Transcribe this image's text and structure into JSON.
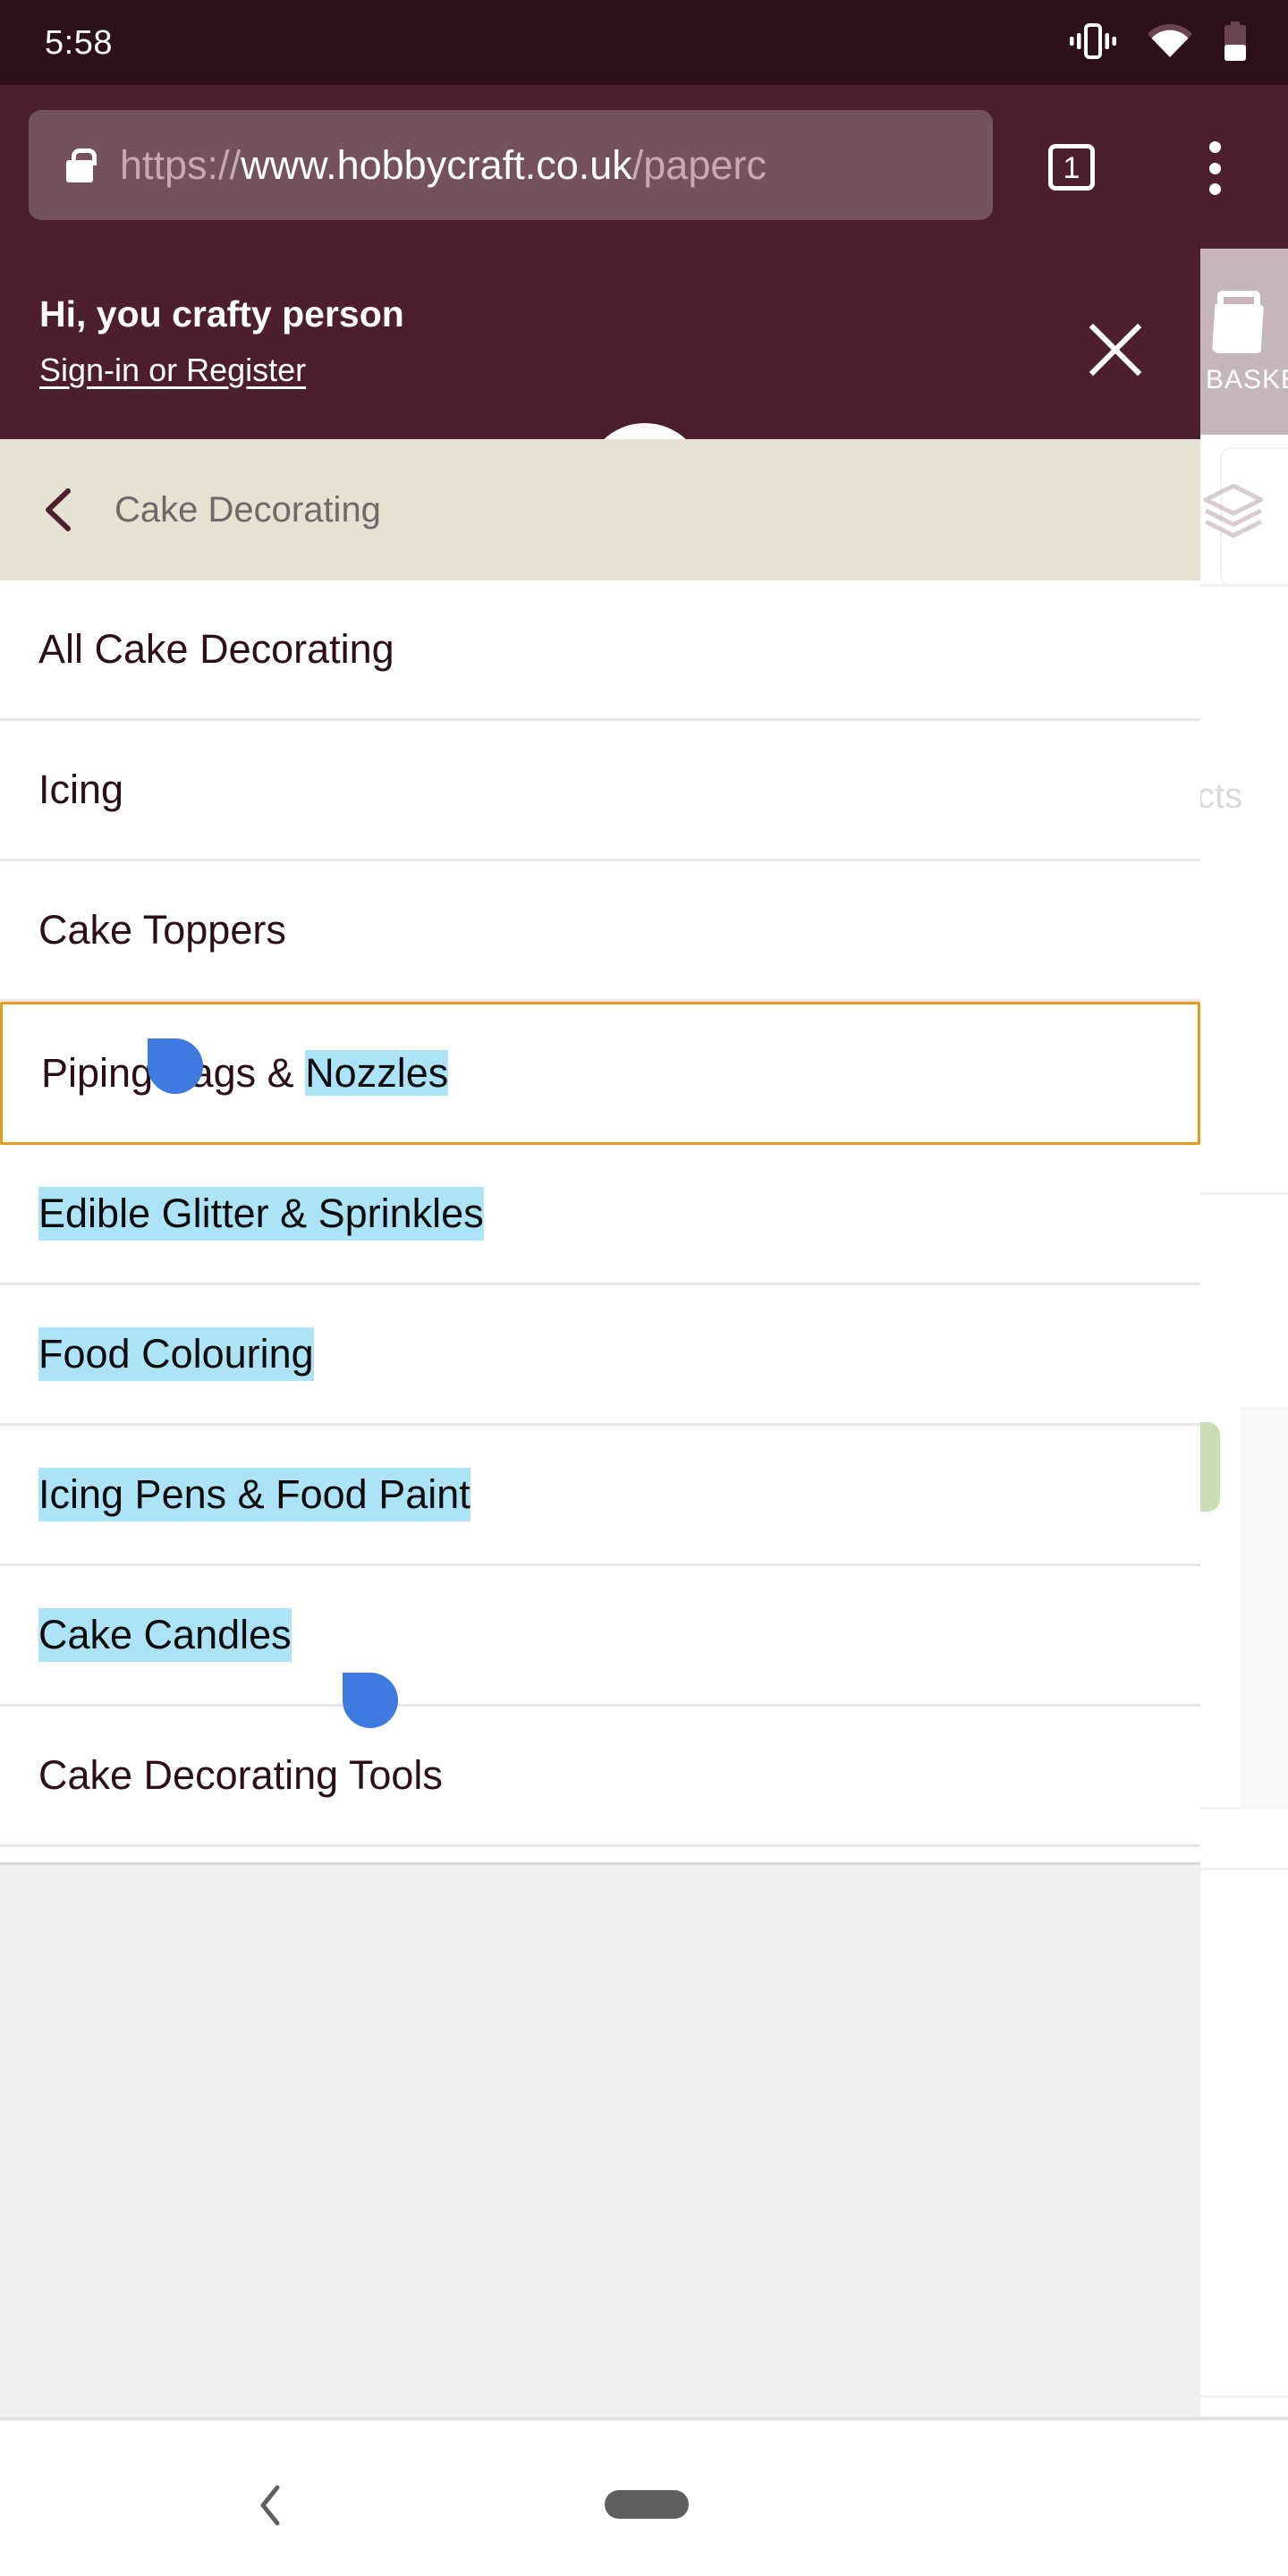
{
  "status_bar": {
    "clock": "5:58",
    "icons": [
      "vibrate-icon",
      "wifi-icon",
      "battery-icon"
    ],
    "battery_level_percent": 40,
    "background_color": "#2c1119"
  },
  "browser": {
    "url_scheme": "https://",
    "url_host": "www.hobbycraft.co.uk",
    "url_path": "/paperc",
    "lock_icon": "lock-icon",
    "tab_count": "1",
    "menu_icon": "overflow-menu-icon",
    "chrome_color": "#4d1f2d"
  },
  "refresh": {
    "icon": "refresh-arrow-icon",
    "accent_color": "#3f7ae0"
  },
  "account_banner": {
    "greeting": "Hi, you crafty person",
    "signin_label": "Sign-in or Register",
    "close_icon": "close-icon",
    "background_color": "#4d1f2d"
  },
  "background_page": {
    "basket_label": "BASKET",
    "basket_icon": "shopping-basket-icon",
    "layers_icon": "layers-icon",
    "products_text": "cts",
    "accent_green": "#c9dfb3",
    "basket_strip_color": "#c6b5bc"
  },
  "category_menu": {
    "header": {
      "back_icon": "chevron-left-icon",
      "title": "Cake Decorating",
      "background_color": "#e5e2d2"
    },
    "items": [
      {
        "label": "All Cake Decorating",
        "selected_row": false,
        "selection": "none"
      },
      {
        "label": "Icing",
        "selected_row": false,
        "selection": "none"
      },
      {
        "label": "Cake Toppers",
        "selected_row": false,
        "selection": "none"
      },
      {
        "label": "Piping Bags & Nozzles",
        "selected_row": true,
        "selection": "partial",
        "unselected_text": "Piping Bags & ",
        "selected_text": "Nozzles"
      },
      {
        "label": "Edible Glitter & Sprinkles",
        "selected_row": false,
        "selection": "full"
      },
      {
        "label": "Food Colouring",
        "selected_row": false,
        "selection": "full"
      },
      {
        "label": "Icing Pens & Food Paint",
        "selected_row": false,
        "selection": "full"
      },
      {
        "label": "Cake Candles",
        "selected_row": false,
        "selection": "full"
      },
      {
        "label": "Cake Decorating Tools",
        "selected_row": false,
        "selection": "none"
      }
    ],
    "focus_outline_color": "#e89b1c",
    "selection_highlight_color": "#ace3f7",
    "selection_handle_color": "#3f7ae0"
  },
  "nav_bar": {
    "back_icon": "nav-back-icon",
    "home_icon": "nav-home-pill"
  }
}
